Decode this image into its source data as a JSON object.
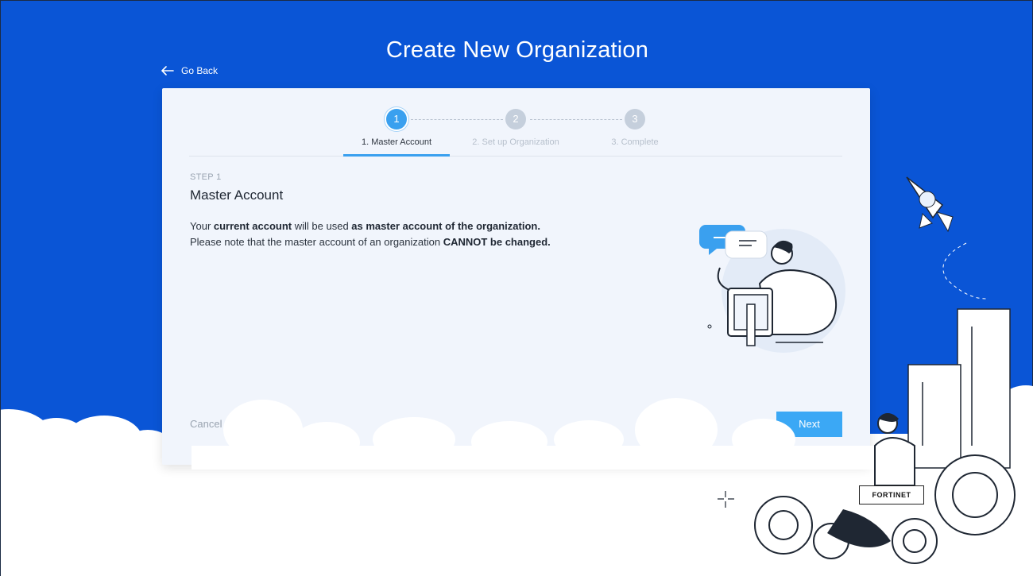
{
  "header": {
    "title": "Create New Organization",
    "go_back_label": "Go Back"
  },
  "stepper": {
    "steps": [
      {
        "number": "1",
        "label": "1. Master Account",
        "state": "active"
      },
      {
        "number": "2",
        "label": "2. Set up Organization",
        "state": "inactive"
      },
      {
        "number": "3",
        "label": "3. Complete",
        "state": "inactive"
      }
    ]
  },
  "content": {
    "eyebrow": "STEP 1",
    "heading": "Master Account",
    "line1_prefix": "Your ",
    "line1_bold1": "current account",
    "line1_middle": " will be used ",
    "line1_bold2": "as master account of the organization.",
    "line2_prefix": "Please note that the master account of an organization ",
    "line2_bold": "CANNOT be changed."
  },
  "actions": {
    "cancel_label": "Cancel",
    "next_label": "Next"
  },
  "branding": {
    "logo_text": "FORTINET"
  },
  "colors": {
    "background": "#0a55d6",
    "accent": "#3aa0ef",
    "button": "#3ba8f5",
    "card": "#f1f5fc"
  },
  "icons": [
    "arrow-left-icon",
    "rocket-icon",
    "support-agent-illustration",
    "gear-icon",
    "building-icon"
  ]
}
